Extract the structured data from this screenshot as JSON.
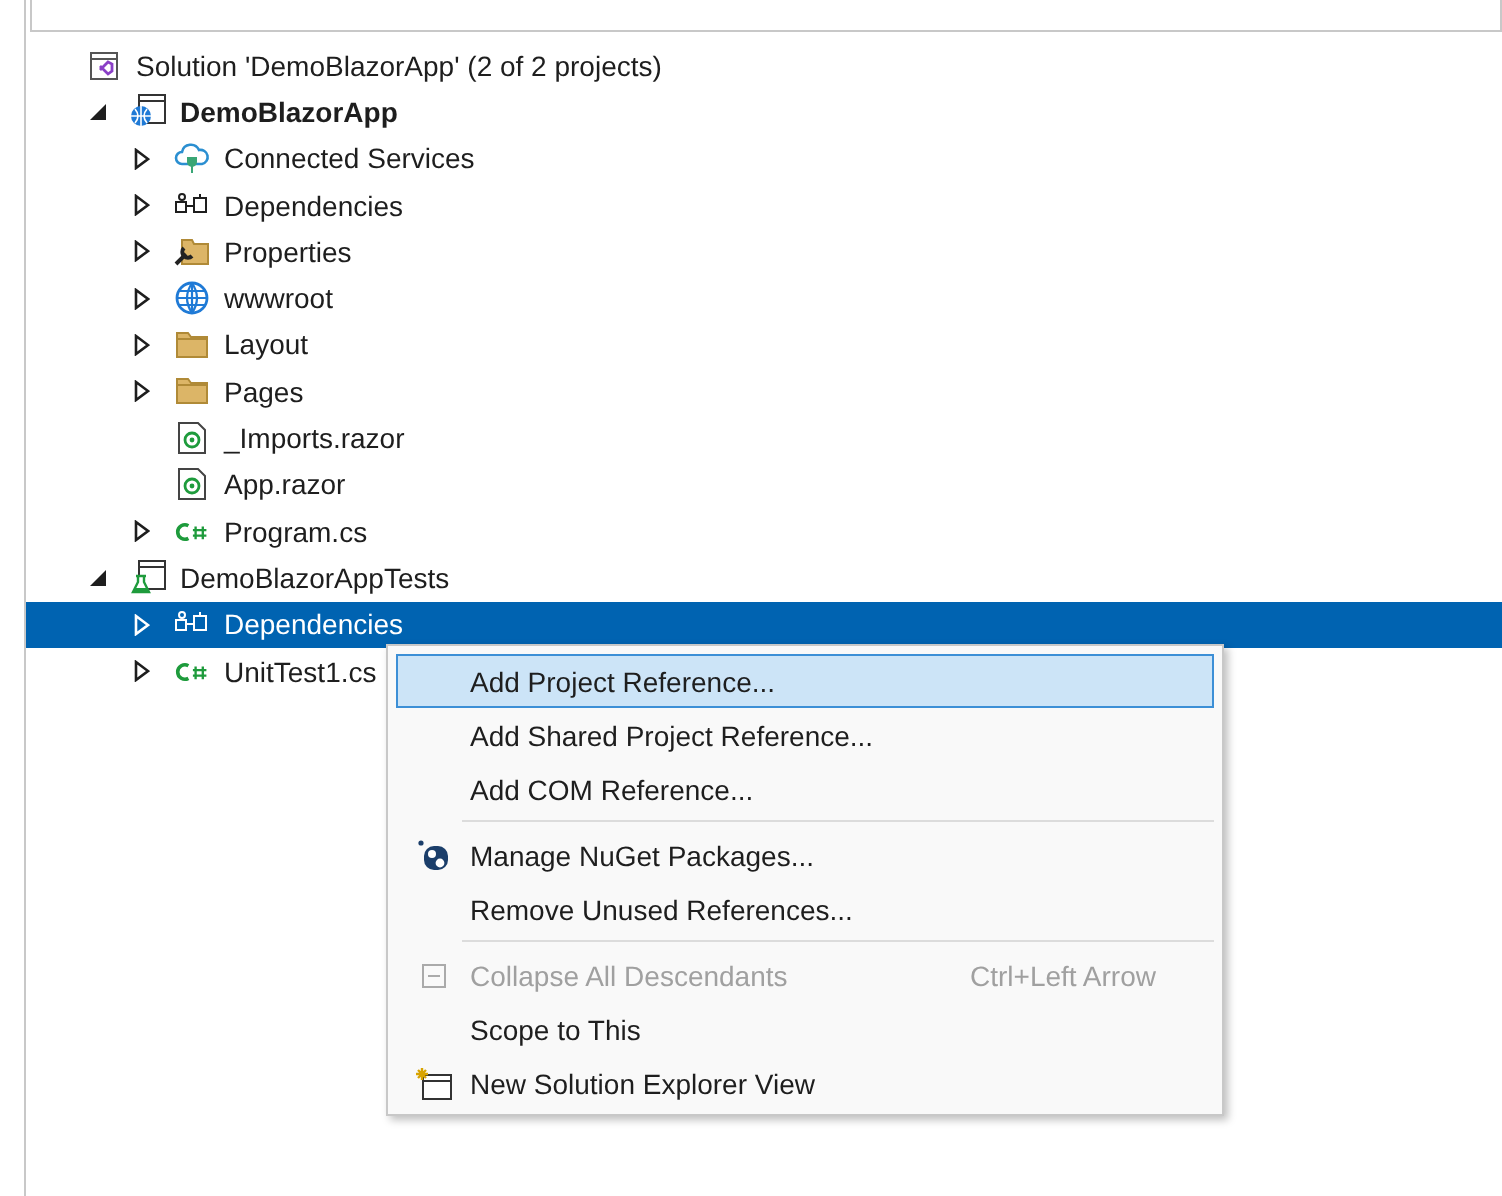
{
  "search_field": {
    "present": true
  },
  "tree": [
    {
      "label": "Solution 'DemoBlazorApp' (2 of 2 projects)",
      "kind": "solution",
      "selected": false,
      "children": [
        {
          "label": "DemoBlazorApp",
          "kind": "web-project",
          "expanded": true,
          "selected": false,
          "bold": true,
          "children": [
            {
              "label": "Connected Services",
              "kind": "connected-services",
              "expanded": false,
              "selected": false
            },
            {
              "label": "Dependencies",
              "kind": "dependencies",
              "expanded": false,
              "selected": false
            },
            {
              "label": "Properties",
              "kind": "properties",
              "expanded": false,
              "selected": false
            },
            {
              "label": "wwwroot",
              "kind": "globe",
              "expanded": false,
              "selected": false
            },
            {
              "label": "Layout",
              "kind": "folder",
              "expanded": false,
              "selected": false
            },
            {
              "label": "Pages",
              "kind": "folder",
              "expanded": false,
              "selected": false
            },
            {
              "label": "_Imports.razor",
              "kind": "razor",
              "selected": false
            },
            {
              "label": "App.razor",
              "kind": "razor",
              "selected": false
            },
            {
              "label": "Program.cs",
              "kind": "csharp",
              "expanded": false,
              "selected": false
            }
          ]
        },
        {
          "label": "DemoBlazorAppTests",
          "kind": "test-project",
          "expanded": true,
          "selected": false,
          "bold": false,
          "children": [
            {
              "label": "Dependencies",
              "kind": "dependencies",
              "expanded": false,
              "selected": true
            },
            {
              "label": "UnitTest1.cs",
              "kind": "csharp",
              "expanded": false,
              "selected": false
            }
          ]
        }
      ]
    }
  ],
  "context_menu": [
    {
      "kind": "item",
      "label": "Add Project Reference...",
      "selected": true,
      "disabled": false
    },
    {
      "kind": "item",
      "label": "Add Shared Project Reference...",
      "selected": false,
      "disabled": false
    },
    {
      "kind": "item",
      "label": "Add COM Reference...",
      "selected": false,
      "disabled": false
    },
    {
      "kind": "separator"
    },
    {
      "kind": "item",
      "label": "Manage NuGet Packages...",
      "selected": false,
      "disabled": false
    },
    {
      "kind": "item",
      "label": "Remove Unused References...",
      "selected": false,
      "disabled": false
    },
    {
      "kind": "separator"
    },
    {
      "kind": "item",
      "label": "Collapse All Descendants",
      "selected": false,
      "disabled": true,
      "shortcut": "Ctrl+Left Arrow"
    },
    {
      "kind": "item",
      "label": "Scope to This",
      "selected": false,
      "disabled": false
    },
    {
      "kind": "item",
      "label": "New Solution Explorer View",
      "selected": false,
      "disabled": false
    }
  ]
}
